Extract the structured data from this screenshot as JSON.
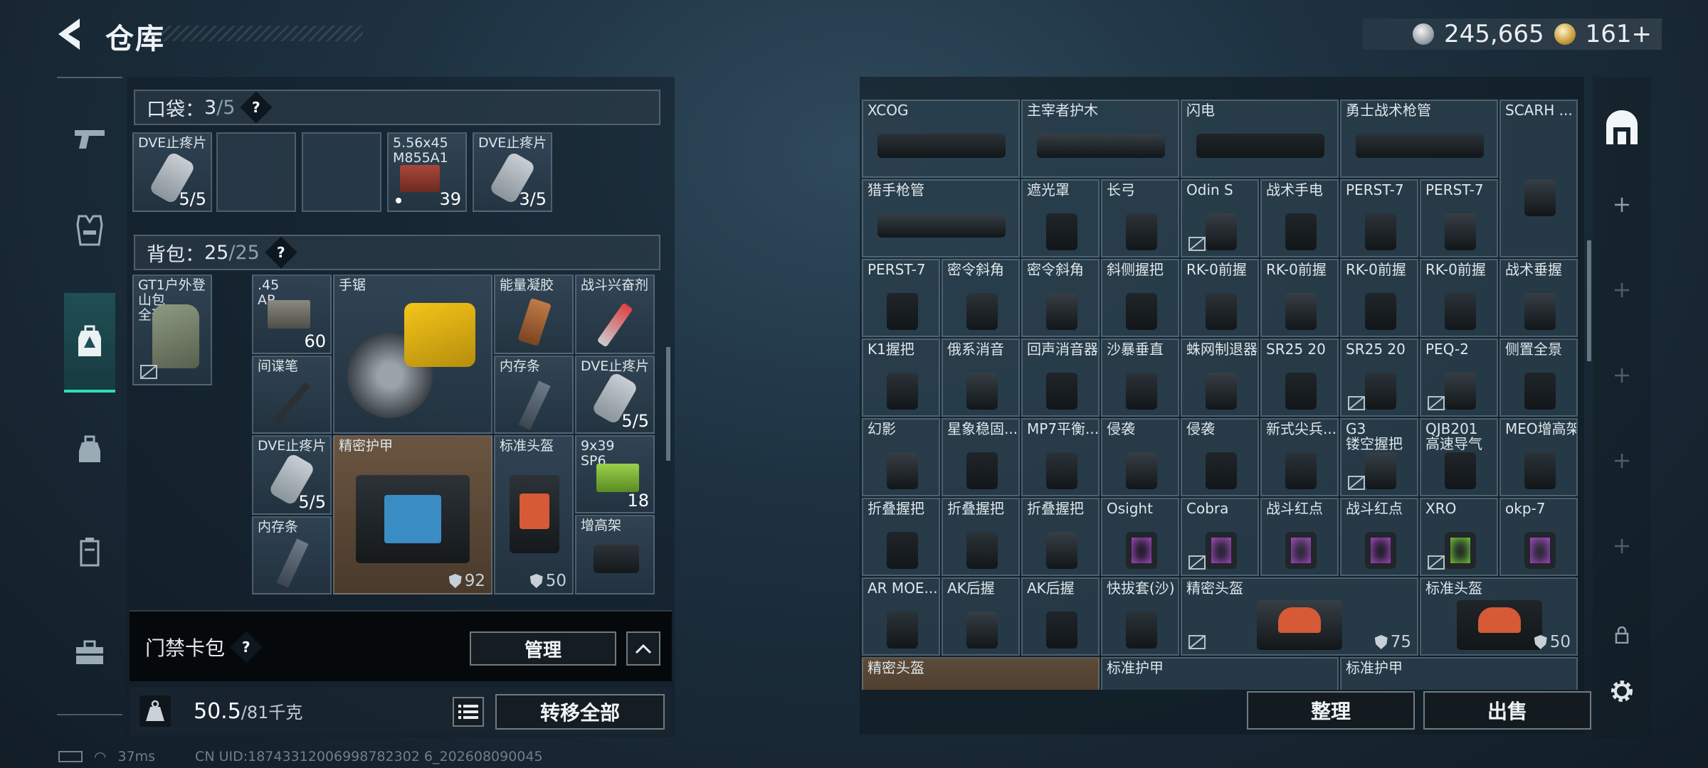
{
  "header": {
    "title": "仓库",
    "silver": "245,665",
    "gold": "161+"
  },
  "pocket": {
    "label": "口袋：",
    "count": "3",
    "capacity": "/5",
    "help": "?"
  },
  "pocket_items": [
    {
      "name": "DVE止疼片",
      "qty": "5/5"
    },
    {
      "name": "5.56x45\nM855A1",
      "qty": "39"
    },
    {
      "name": "DVE止疼片",
      "qty": "3/5"
    }
  ],
  "backpack": {
    "label": "背包：",
    "count": "25",
    "capacity": "/25",
    "help": "?"
  },
  "backpack_items": {
    "bag": "GT1户外登山包",
    "bag_sub": "全球",
    "ammo45": ".45\nAP",
    "ammo45_qty": "60",
    "saw": "手锯",
    "energy_gel": "能量凝胶",
    "stim": "战斗兴奋剂",
    "spy_pen": "间谍笔",
    "ram1": "内存条",
    "dve1": "DVE止疼片",
    "dve1_qty": "5/5",
    "dve2": "DVE止疼片",
    "dve2_qty": "5/5",
    "armor": "精密护甲",
    "armor_dur": "92",
    "helmet": "标准头盔",
    "helmet_dur": "50",
    "ammo939": "9x39\nSP6",
    "ammo939_qty": "18",
    "ram2": "内存条",
    "riser": "增高架"
  },
  "keycard": {
    "label": "门禁卡包",
    "help": "?",
    "manage": "管理"
  },
  "weight": {
    "value": "50.5",
    "max": "/81千克",
    "transfer": "转移全部"
  },
  "storage": {
    "rows": [
      [
        "XCOG",
        "主宰者护木",
        "闪电",
        "勇士战术枪管",
        "SCARH ..."
      ],
      [
        "猎手枪管",
        "遮光罩",
        "长弓",
        "Odin S",
        "战术手电",
        "PERST-7",
        "PERST-7"
      ],
      [
        "PERST-7",
        "密令斜角",
        "密令斜角",
        "斜侧握把",
        "RK-0前握",
        "RK-0前握",
        "RK-0前握",
        "RK-0前握",
        "战术垂握"
      ],
      [
        "K1握把",
        "俄系消音",
        "回声消音器",
        "沙暴垂直",
        "蛛网制退器",
        "SR25 20",
        "SR25 20",
        "PEQ-2",
        "侧置全景"
      ],
      [
        "幻影",
        "星象稳固...",
        "MP7平衡...",
        "侵袭",
        "侵袭",
        "新式尖兵...",
        "G3\n镂空握把",
        "QJB201\n高速导气",
        "MEO增高架"
      ],
      [
        "折叠握把",
        "折叠握把",
        "折叠握把",
        "Osight",
        "Cobra",
        "战斗红点",
        "战斗红点",
        "XRO",
        "okp-7"
      ],
      [
        "AR MOE...",
        "AK后握",
        "AK后握",
        "快拔套(沙)",
        "精密头盔",
        "标准头盔"
      ],
      [
        "精密头盔",
        "标准护甲",
        "标准护甲"
      ]
    ],
    "helmet_precise_dur": "75",
    "helmet_std_dur": "50",
    "sort": "整理",
    "sell": "出售"
  },
  "status": {
    "ping": "37ms",
    "uid": "CN UID:18743312006998782302 6_202608090045"
  },
  "colors": {
    "accent": "#2ddfb8",
    "orange_slot": "#6a5540"
  }
}
